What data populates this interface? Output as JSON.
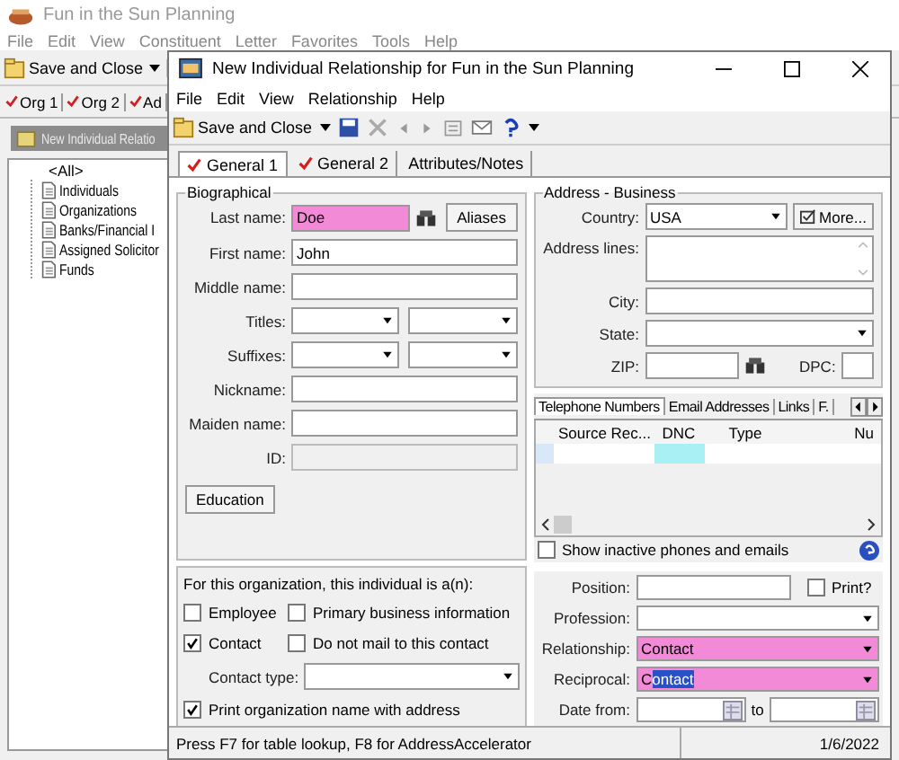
{
  "app": {
    "title": "Fun in the Sun Planning",
    "menu": [
      "File",
      "Edit",
      "View",
      "Constituent",
      "Letter",
      "Favorites",
      "Tools",
      "Help"
    ],
    "save_label": "Save and Close",
    "tabs": [
      {
        "label": "Org 1",
        "checked": true
      },
      {
        "label": "Org 2",
        "checked": true
      },
      {
        "label": "Ad",
        "checked": true
      }
    ],
    "subwindow_title": "New Individual Relatio",
    "tree": {
      "label": "<All>",
      "children": [
        {
          "label": "Individuals"
        },
        {
          "label": "Organizations"
        },
        {
          "label": "Banks/Financial I"
        },
        {
          "label": "Assigned Solicitor"
        },
        {
          "label": "Funds"
        }
      ]
    }
  },
  "dialog": {
    "title": "New Individual Relationship for Fun in the Sun Planning",
    "menu": [
      "File",
      "Edit",
      "View",
      "Relationship",
      "Help"
    ],
    "save_label": "Save and Close",
    "tabs": [
      {
        "label": "General 1",
        "checked": true,
        "selected": true
      },
      {
        "label": "General 2",
        "checked": true,
        "selected": false
      },
      {
        "label": "Attributes/Notes",
        "checked": false,
        "selected": false
      }
    ],
    "biographical": {
      "title": "Biographical",
      "aliases_button": "Aliases",
      "education_button": "Education",
      "fields": [
        {
          "kind": "lookup",
          "label": "Last name:",
          "value": "Doe",
          "required": true
        },
        {
          "kind": "text",
          "label": "First name:",
          "value": "John",
          "disabled": false
        },
        {
          "kind": "text",
          "label": "Middle name:",
          "disabled": false
        },
        {
          "kind": "combo2",
          "label": "Titles:"
        },
        {
          "kind": "combo2",
          "label": "Suffixes:"
        },
        {
          "kind": "text",
          "label": "Nickname:",
          "disabled": false
        },
        {
          "kind": "text",
          "label": "Maiden name:",
          "disabled": false
        },
        {
          "kind": "text",
          "label": "ID:",
          "disabled": true
        }
      ]
    },
    "address": {
      "title": "Address - Business",
      "country_label": "Country:",
      "country": "USA",
      "more_button": "More...",
      "lines_label": "Address lines:",
      "city_label": "City:",
      "state_label": "State:",
      "zip_label": "ZIP:",
      "dpc_label": "DPC:"
    },
    "contact_tabs": [
      {
        "label": "Telephone Numbers",
        "selected": true
      },
      {
        "label": "Email Addresses",
        "selected": false
      },
      {
        "label": "Links",
        "selected": false
      },
      {
        "label": "F.",
        "selected": false
      }
    ],
    "phone_columns": [
      "Source Rec...",
      "DNC",
      "Type",
      "Nu"
    ],
    "show_inactive": {
      "label": "Show inactive phones and emails",
      "checked": false
    },
    "organization": {
      "heading": "For this organization, this individual is a(n):",
      "options": [
        {
          "label": "Employee",
          "checked": false
        },
        {
          "label": "Primary business information",
          "checked": false
        },
        {
          "label": "Contact",
          "checked": true
        },
        {
          "label": "Do not mail to this contact",
          "checked": false
        }
      ],
      "contact_type_label": "Contact type:",
      "print_name": {
        "label": "Print organization name with address",
        "checked": true
      }
    },
    "position_label": "Position:",
    "print_check": {
      "label": "Print?",
      "checked": false
    },
    "profession_label": "Profession:",
    "relationship": {
      "label": "Relationship:",
      "value": "Contact",
      "required": true
    },
    "reciprocal": {
      "label": "Reciprocal:",
      "value": "C",
      "selected_text": "ontact",
      "required": true
    },
    "date_from_label": "Date from:",
    "date_to_label": "to",
    "status": {
      "hint": "Press F7 for table lookup, F8 for AddressAccelerator",
      "date": "1/6/2022"
    }
  }
}
